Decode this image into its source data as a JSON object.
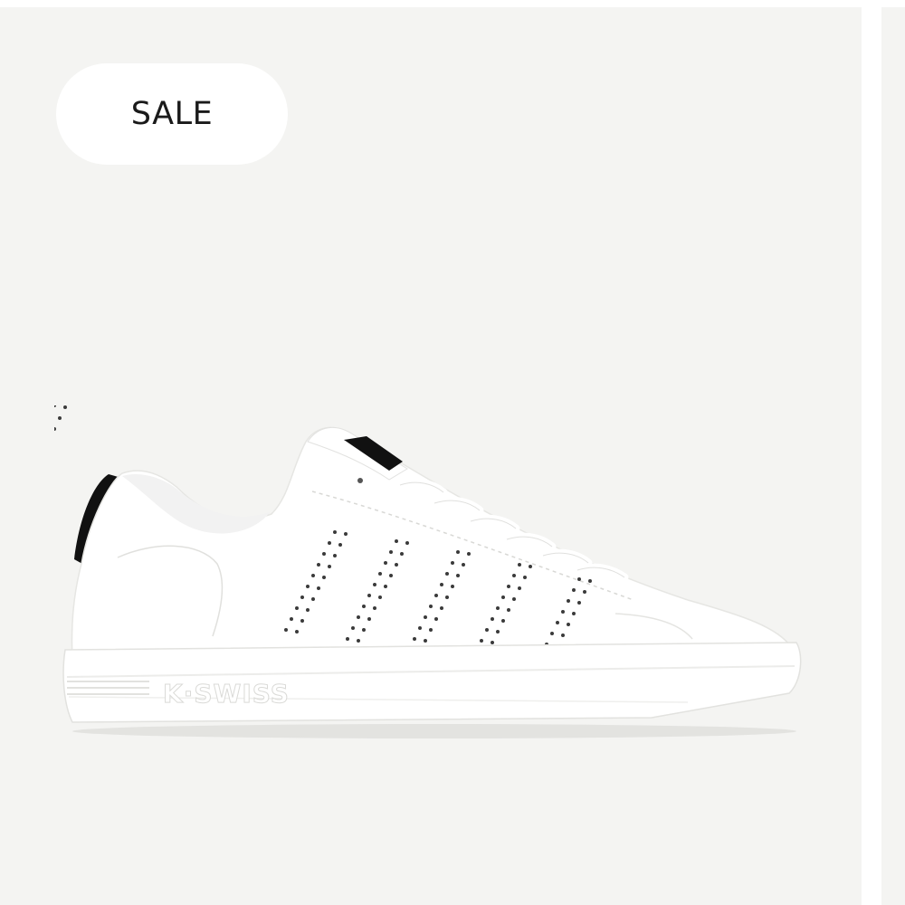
{
  "badge": {
    "label": "SALE"
  },
  "product": {
    "image_icon": "sneaker-icon",
    "brand_mark": "K·SWISS",
    "colors": {
      "upper": "#ffffff",
      "heel_tab": "#111111",
      "card_background": "#f4f4f2",
      "badge_background": "#ffffff"
    }
  },
  "next_card": {
    "visible": true
  }
}
